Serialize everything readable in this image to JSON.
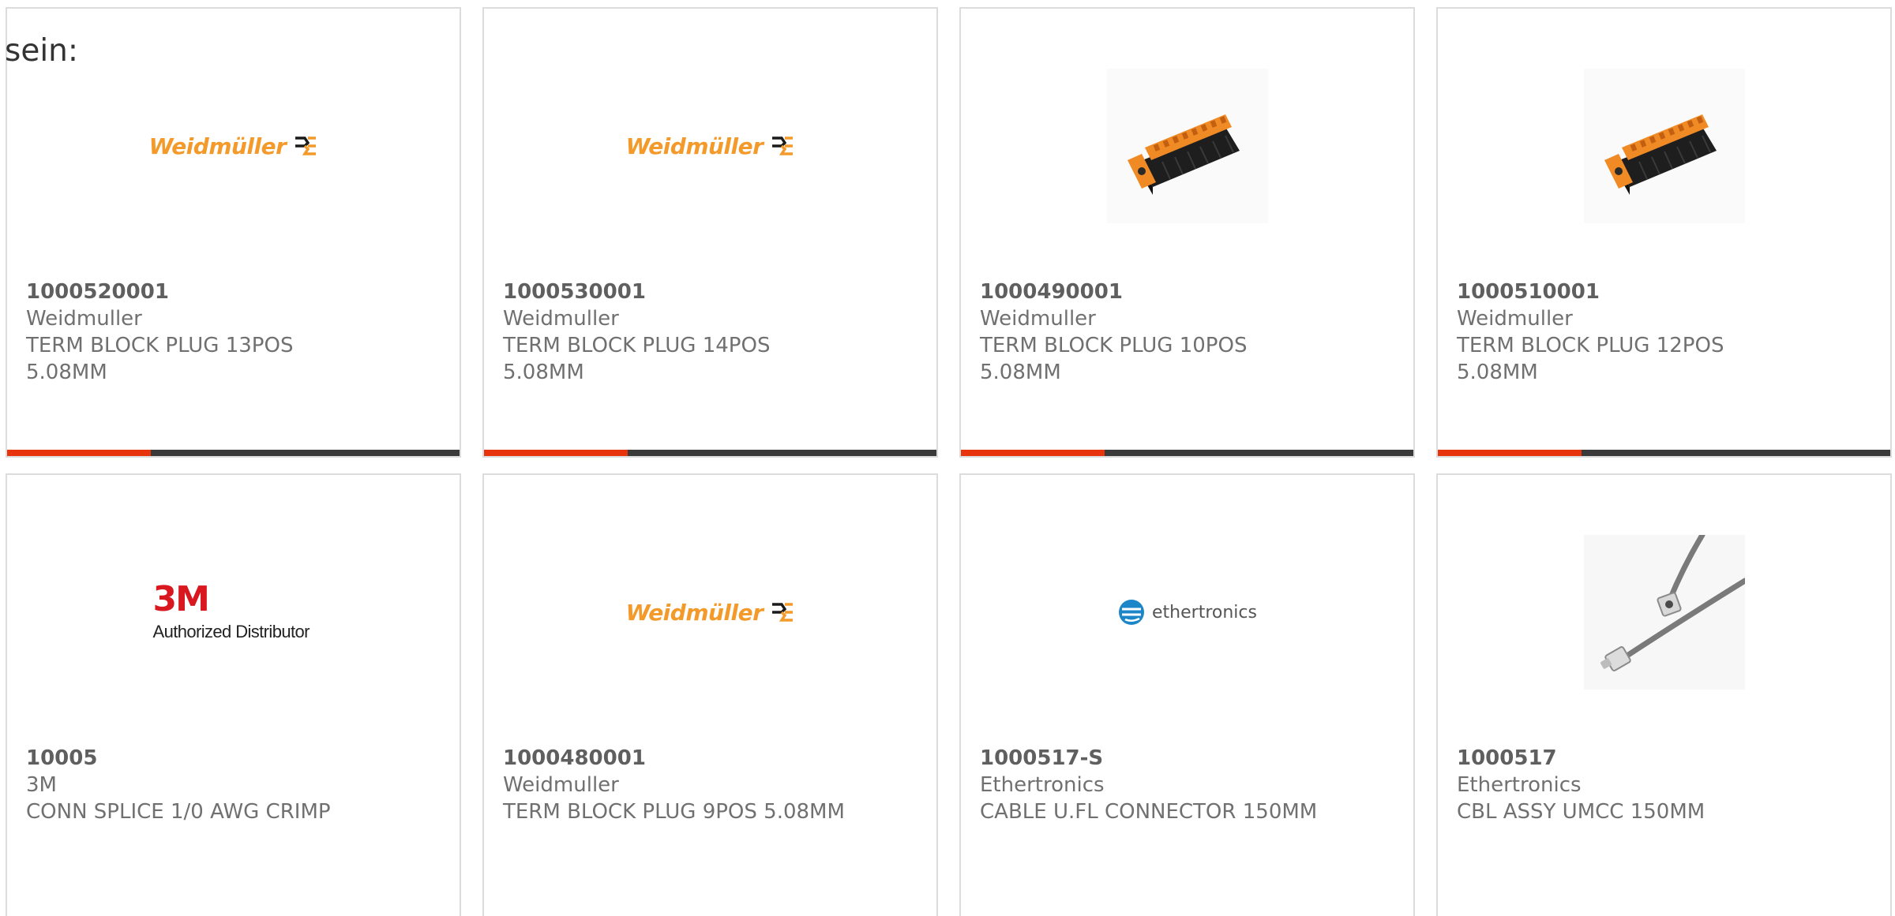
{
  "intro_text": "sein:",
  "products": [
    {
      "part_number": "1000520001",
      "manufacturer": "Weidmuller",
      "description_line1": "TERM BLOCK PLUG 13POS",
      "description_line2": "5.08MM",
      "thumbnail": "weidmuller-logo",
      "logo_text": "Weidmüller"
    },
    {
      "part_number": "1000530001",
      "manufacturer": "Weidmuller",
      "description_line1": "TERM BLOCK PLUG 14POS",
      "description_line2": "5.08MM",
      "thumbnail": "weidmuller-logo",
      "logo_text": "Weidmüller"
    },
    {
      "part_number": "1000490001",
      "manufacturer": "Weidmuller",
      "description_line1": "TERM BLOCK PLUG 10POS",
      "description_line2": "5.08MM",
      "thumbnail": "terminal-block-photo"
    },
    {
      "part_number": "1000510001",
      "manufacturer": "Weidmuller",
      "description_line1": "TERM BLOCK PLUG 12POS",
      "description_line2": "5.08MM",
      "thumbnail": "terminal-block-photo"
    },
    {
      "part_number": "10005",
      "manufacturer": "3M",
      "description_line1": "CONN SPLICE 1/0 AWG CRIMP",
      "description_line2": "",
      "thumbnail": "3m-logo",
      "logo_text": "3M",
      "logo_subtext": "Authorized Distributor"
    },
    {
      "part_number": "1000480001",
      "manufacturer": "Weidmuller",
      "description_line1": "TERM BLOCK PLUG 9POS 5.08MM",
      "description_line2": "",
      "thumbnail": "weidmuller-logo",
      "logo_text": "Weidmüller"
    },
    {
      "part_number": "1000517-S",
      "manufacturer": "Ethertronics",
      "description_line1": "CABLE U.FL CONNECTOR 150MM",
      "description_line2": "",
      "thumbnail": "ethertronics-logo",
      "logo_text": "ethertronics"
    },
    {
      "part_number": "1000517",
      "manufacturer": "Ethertronics",
      "description_line1": "CBL ASSY UMCC 150MM",
      "description_line2": "",
      "thumbnail": "cable-assembly-photo"
    }
  ],
  "colors": {
    "accent": "#e8340c",
    "bar": "#3a3a3a",
    "card_border": "#dcdcdc",
    "weidmuller_orange": "#f39a2a",
    "mmm_red": "#d8171e",
    "ethertronics_blue": "#1b86c8"
  }
}
